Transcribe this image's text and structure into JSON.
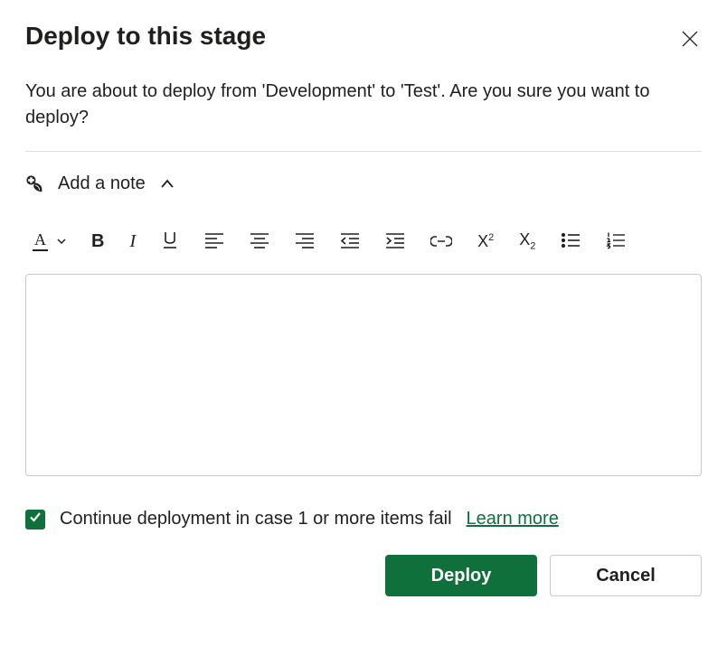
{
  "header": {
    "title": "Deploy to this stage"
  },
  "description": "You are about to deploy from 'Development' to 'Test'. Are you sure you want to deploy?",
  "note_section": {
    "label": "Add a note",
    "expanded": true,
    "value": ""
  },
  "toolbar": {
    "font_color": "font-color",
    "bold": "bold",
    "italic": "italic",
    "underline": "underline",
    "align_left": "align-left",
    "align_center": "align-center",
    "align_right": "align-right",
    "outdent": "decrease-indent",
    "indent": "increase-indent",
    "link": "insert-link",
    "superscript": "superscript",
    "subscript": "subscript",
    "bulleted_list": "bulleted-list",
    "numbered_list": "numbered-list"
  },
  "continue": {
    "checked": true,
    "label": "Continue deployment in case 1 or more items fail",
    "learn_more": "Learn more"
  },
  "actions": {
    "primary": "Deploy",
    "secondary": "Cancel"
  },
  "icons": {
    "close": "close-icon",
    "add_note": "add-note-icon",
    "chevron_up": "chevron-up-icon"
  }
}
